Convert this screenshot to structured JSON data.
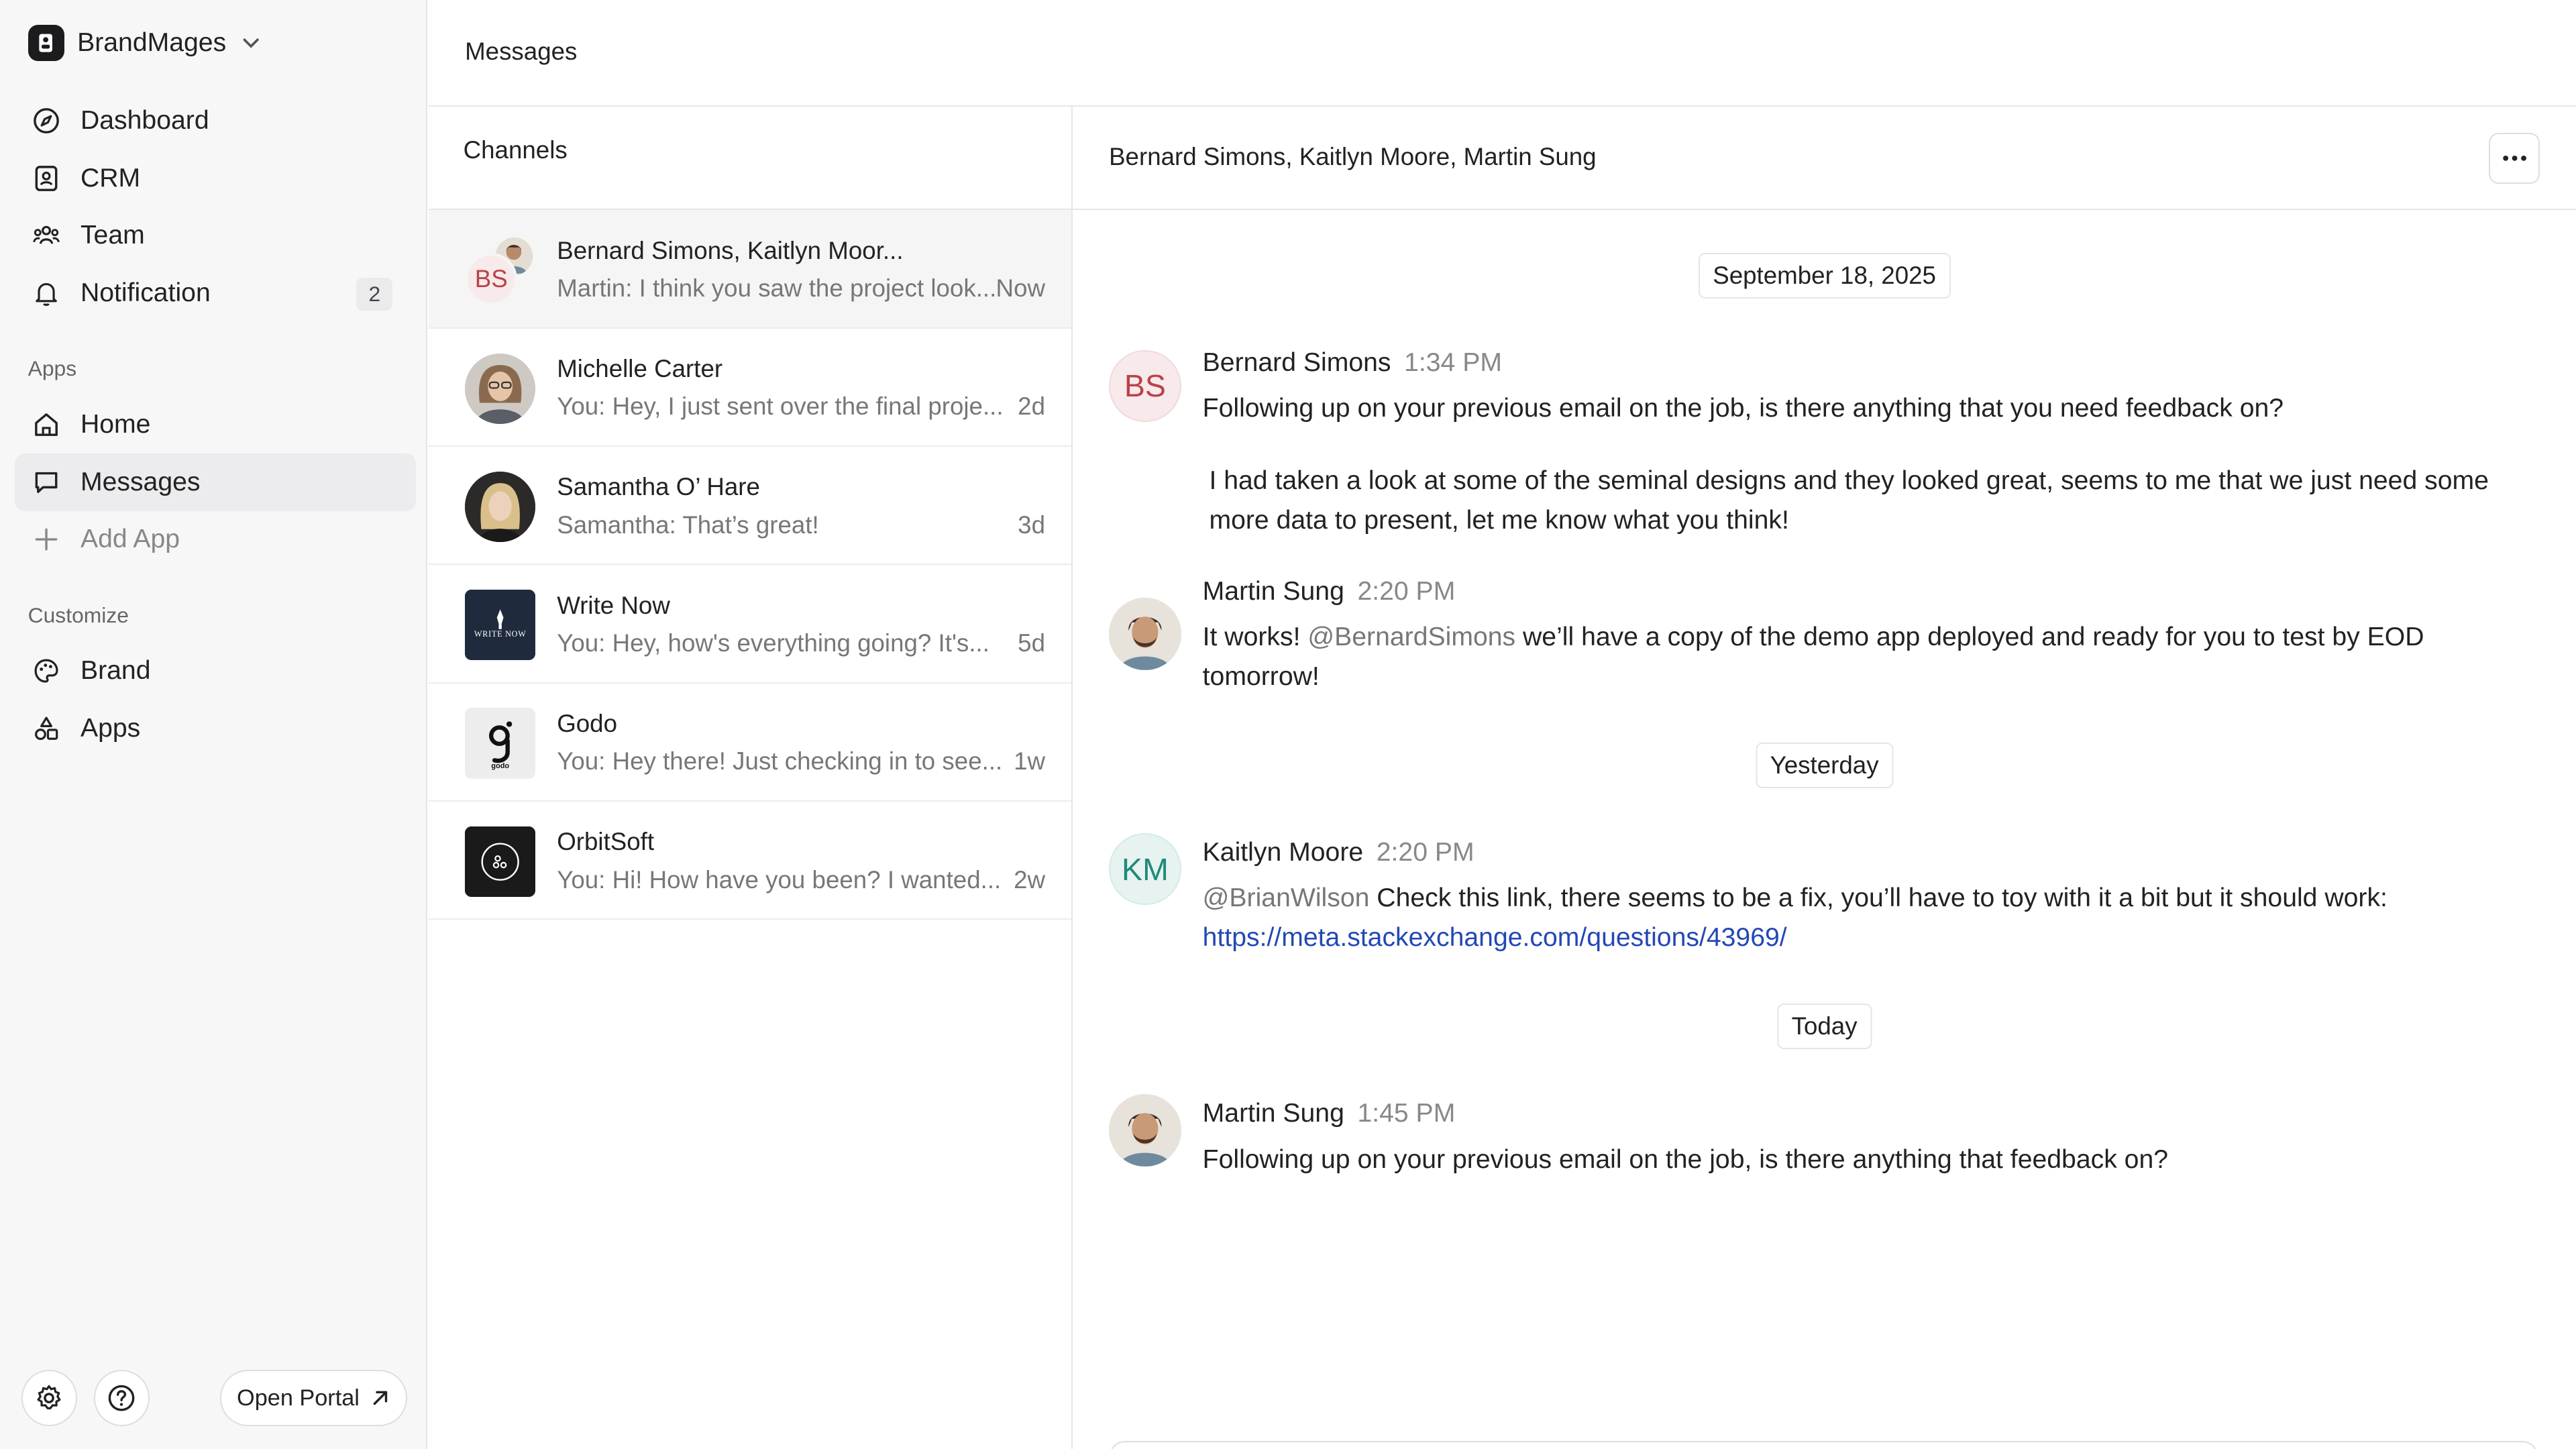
{
  "workspace": {
    "name": "BrandMages"
  },
  "nav": {
    "main": [
      {
        "label": "Dashboard",
        "icon": "compass-icon"
      },
      {
        "label": "CRM",
        "icon": "contact-card-icon"
      },
      {
        "label": "Team",
        "icon": "team-icon"
      },
      {
        "label": "Notification",
        "icon": "bell-icon",
        "badge": "2"
      }
    ],
    "apps_label": "Apps",
    "apps": [
      {
        "label": "Home",
        "icon": "home-icon"
      },
      {
        "label": "Messages",
        "icon": "message-icon",
        "active": true
      },
      {
        "label": "Add App",
        "icon": "plus-icon"
      }
    ],
    "customize_label": "Customize",
    "customize": [
      {
        "label": "Brand",
        "icon": "palette-icon"
      },
      {
        "label": "Apps",
        "icon": "shapes-icon"
      }
    ],
    "open_portal": "Open Portal"
  },
  "topbar": {
    "title": "Messages"
  },
  "channels": {
    "title": "Channels",
    "items": [
      {
        "name": "Bernard Simons, Kaitlyn Moor...",
        "preview": "Martin: I think you saw the project look...",
        "time": "Now",
        "avatar_initials": "BS"
      },
      {
        "name": "Michelle Carter",
        "preview": "You: Hey, I just sent over the final proje...",
        "time": "2d"
      },
      {
        "name": "Samantha O’ Hare",
        "preview": "Samantha: That’s great!",
        "time": "3d"
      },
      {
        "name": "Write Now",
        "preview": "You: Hey, how's everything going? It's...",
        "time": "5d",
        "logo_text": "WRITE NOW"
      },
      {
        "name": "Godo",
        "preview": "You: Hey there! Just checking in to see...",
        "time": "1w",
        "logo_text": "godo"
      },
      {
        "name": "OrbitSoft",
        "preview": "You: Hi! How have you been? I wanted...",
        "time": "2w"
      }
    ]
  },
  "chat": {
    "title": "Bernard Simons, Kaitlyn Moore, Martin Sung",
    "dates": [
      "September 18, 2025",
      "Yesterday",
      "Today"
    ],
    "messages": [
      {
        "author": "Bernard Simons",
        "time": "1:34 PM",
        "initials": "BS",
        "text": "Following up on your previous email on the job, is there anything that you need feedback on?",
        "text2": "I had taken a look at some of the seminal designs and they looked great, seems to me that we just need some more data to present, let me know what you think!"
      },
      {
        "author": "Martin Sung",
        "time": "2:20 PM",
        "text_before": "It works! ",
        "mention": "@BernardSimons",
        "text_after": " we’ll have a copy of the demo app deployed and ready for you to test by EOD tomorrow!"
      },
      {
        "author": "Kaitlyn Moore",
        "time": "2:20 PM",
        "initials": "KM",
        "mention": "@BrianWilson",
        "text_after": " Check this link, there seems to be a fix, you’ll have to toy with it a bit but it should work: ",
        "link": "https://meta.stackexchange.com/questions/43969/"
      },
      {
        "author": "Martin Sung",
        "time": "1:45 PM",
        "text": "Following up on your previous email on the job, is there anything that feedback on?"
      }
    ]
  },
  "colors": {
    "accent_red": "#b8424a",
    "accent_teal": "#1f8a78",
    "link": "#2348b5"
  }
}
